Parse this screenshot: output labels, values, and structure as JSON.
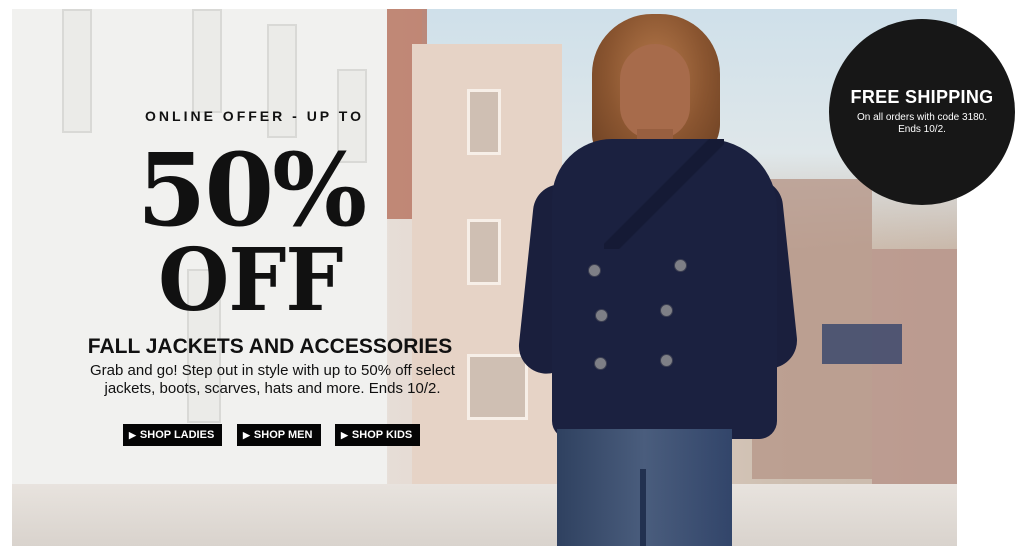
{
  "promo": {
    "eyebrow": "ONLINE OFFER - UP TO",
    "percent": "50%",
    "off": "OFF",
    "headline": "FALL JACKETS AND ACCESSORIES",
    "description": "Grab and go! Step out in style with up to 50% off select jackets, boots, scarves, hats and more. Ends 10/2.",
    "buttons": [
      {
        "label": "SHOP LADIES",
        "icon": "chevron-right-icon"
      },
      {
        "label": "SHOP MEN",
        "icon": "chevron-right-icon"
      },
      {
        "label": "SHOP KIDS",
        "icon": "chevron-right-icon"
      }
    ]
  },
  "badge": {
    "title": "FREE SHIPPING",
    "details": "On all orders with code 3180. Ends 10/2."
  },
  "colors": {
    "button_bg": "#050505",
    "badge_bg": "#171717",
    "coat": "#1b2140"
  }
}
